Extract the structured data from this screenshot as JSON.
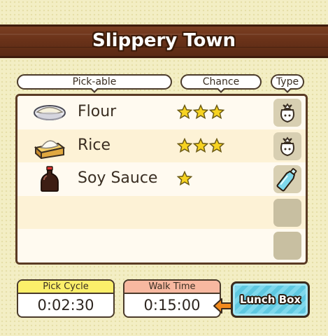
{
  "title": "Slippery Town",
  "headers": {
    "pickable": "Pick-able",
    "chance": "Chance",
    "type": "Type"
  },
  "items": [
    {
      "name": "Flour",
      "icon": "flour-bowl-icon",
      "stars": 3,
      "type_icon": "sack-icon"
    },
    {
      "name": "Rice",
      "icon": "rice-box-icon",
      "stars": 3,
      "type_icon": "sack-icon"
    },
    {
      "name": "Soy Sauce",
      "icon": "soy-sauce-bottle-icon",
      "stars": 1,
      "type_icon": "bottle-icon"
    },
    {
      "name": "",
      "icon": "",
      "stars": 0,
      "type_icon": "empty-slot"
    },
    {
      "name": "",
      "icon": "",
      "stars": 0,
      "type_icon": "empty-slot"
    }
  ],
  "pick_cycle": {
    "label": "Pick Cycle",
    "value": "0:02:30",
    "color": "#fbef6a"
  },
  "walk_time": {
    "label": "Walk Time",
    "value": "0:15:00",
    "color": "#f7b8a0"
  },
  "lunch_box": {
    "label": "Lunch Box"
  },
  "colors": {
    "plank": "#6a3219",
    "star": "#f7d320",
    "lunch_box": "#5fc8e0",
    "arrow": "#f28a1c"
  }
}
